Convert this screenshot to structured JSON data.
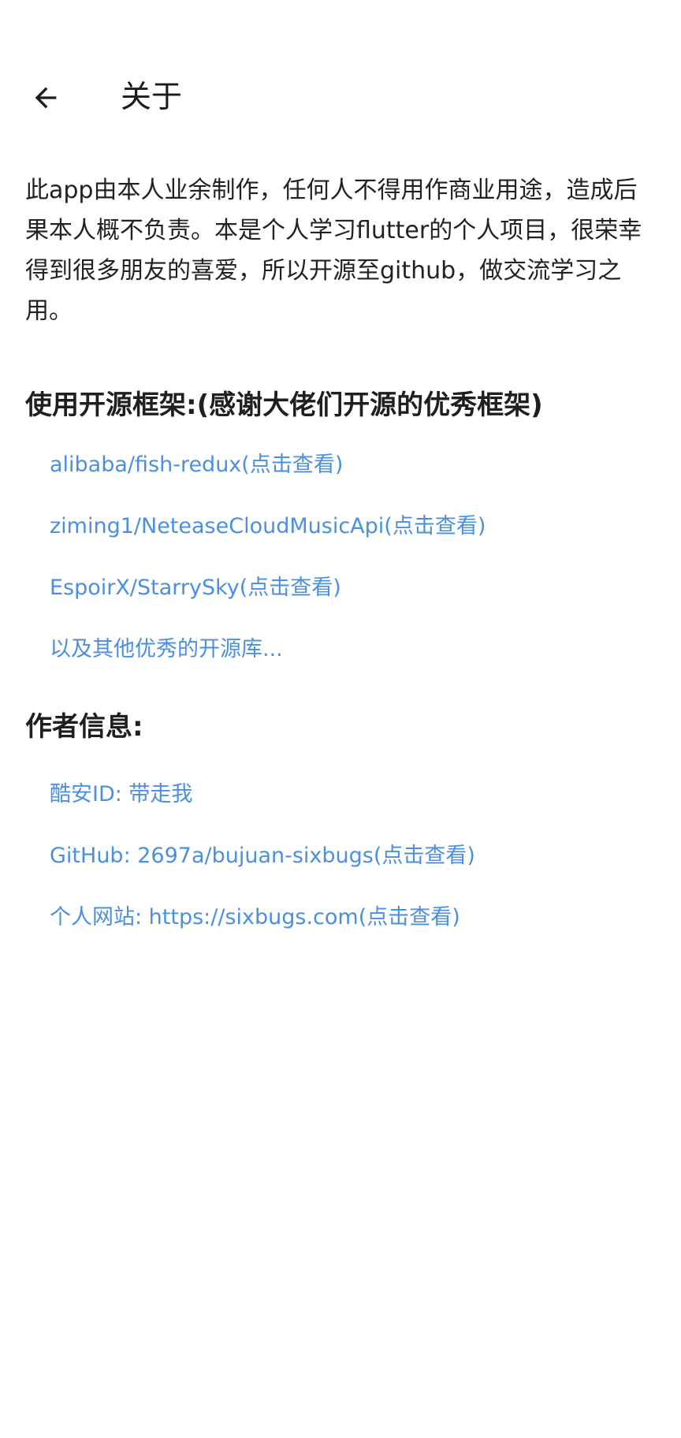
{
  "app_bar": {
    "back_icon": "arrow-left-icon",
    "title": "关于"
  },
  "intro": "此app由本人业余制作，任何人不得用作商业用途，造成后果本人概不负责。本是个人学习flutter的个人项目，很荣幸得到很多朋友的喜爱，所以开源至github，做交流学习之用。",
  "frameworks": {
    "title": "使用开源框架:(感谢大佬们开源的优秀框架)",
    "items": [
      {
        "label": "alibaba/fish-redux(点击查看)"
      },
      {
        "label": "ziming1/NeteaseCloudMusicApi(点击查看)"
      },
      {
        "label": "EspoirX/StarrySky(点击查看)"
      },
      {
        "label": "以及其他优秀的开源库..."
      }
    ]
  },
  "author": {
    "title": "作者信息:",
    "items": [
      {
        "label": "酷安ID: 带走我"
      },
      {
        "label": "GitHub: 2697a/bujuan-sixbugs(点击查看)"
      },
      {
        "label": "个人网站: https://sixbugs.com(点击查看)"
      }
    ]
  },
  "colors": {
    "link": "#4a8fe0",
    "text": "#222222",
    "background": "#ffffff"
  }
}
